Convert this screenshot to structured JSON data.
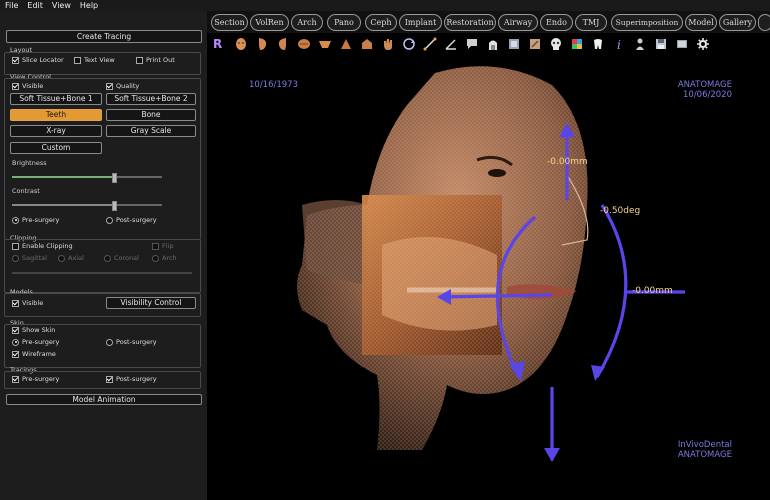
{
  "menu": [
    "File",
    "Edit",
    "View",
    "Help"
  ],
  "left_panel": {
    "create_tracing": "Create Tracing",
    "layout": {
      "title": "Layout",
      "slice_locator": "Slice Locator",
      "text_view": "Text View",
      "print_out": "Print Out"
    },
    "view_control": {
      "title": "View Control",
      "visible": "Visible",
      "quality": "Quality",
      "presets": [
        "Soft Tissue+Bone 1",
        "Soft Tissue+Bone 2",
        "Teeth",
        "Bone",
        "X-ray",
        "Gray Scale",
        "Custom"
      ],
      "active_preset": "Teeth",
      "brightness": "Brightness",
      "brightness_level": 0.68,
      "contrast": "Contrast",
      "contrast_level": 0.68,
      "pre_surgery": "Pre-surgery",
      "post_surgery": "Post-surgery"
    },
    "clipping": {
      "title": "Clipping",
      "enable": "Enable Clipping",
      "flip": "Flip",
      "sagittal": "Sagittal",
      "axial": "Axial",
      "coronal": "Coronal",
      "arch": "Arch"
    },
    "models": {
      "title": "Models",
      "visible": "Visible",
      "visibility_control": "Visibility Control"
    },
    "skin": {
      "title": "Skin",
      "show_skin": "Show Skin",
      "pre_surgery": "Pre-surgery",
      "post_surgery": "Post-surgery",
      "wireframe": "Wireframe"
    },
    "tracings": {
      "title": "Tracings",
      "pre_surgery": "Pre-surgery",
      "post_surgery": "Post-surgery"
    },
    "model_animation": "Model Animation"
  },
  "tabs": [
    "Section",
    "VolRen",
    "Arch",
    "Pano",
    "Ceph",
    "Implant",
    "Restoration",
    "Airway",
    "Endo",
    "TMJ",
    "Superimposition",
    "Model",
    "Gallery"
  ],
  "toolbar": {
    "r_label": "R",
    "i_label": "i"
  },
  "viewport": {
    "date_left": "10/16/1973",
    "brand_top": "ANATOMAGE",
    "date_right": "10/06/2020",
    "brand_bottom_1": "InVivoDental",
    "brand_bottom_2": "ANATOMAGE",
    "measure_top": "-0.00mm",
    "measure_rot": "-0.50deg",
    "measure_right": "-0.00mm"
  },
  "colors": {
    "accent": "#e49a32",
    "overlay_text": "#7a7ae0",
    "measure_text": "#f4d38a",
    "gizmo": "#5a46e8"
  }
}
